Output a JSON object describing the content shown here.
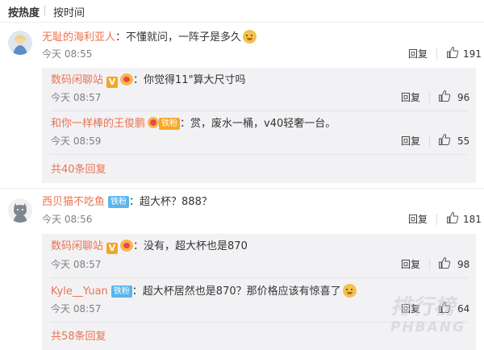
{
  "sort": {
    "hot": "按热度",
    "time": "按时间"
  },
  "comments": [
    {
      "user": "无耻的海利亚人",
      "text": "不懂就问，一阵子是多久",
      "time": "今天 08:55",
      "reply_label": "回复",
      "likes": "191",
      "replies": [
        {
          "user": "数码闲聊站",
          "text": "你觉得11\"算大尺寸吗",
          "time": "今天 08:57",
          "reply_label": "回复",
          "likes": "96"
        },
        {
          "user": "和你一样棒的王俊鹏",
          "fan_tag": "铁粉",
          "text": "赏，废水一桶，v40轻奢一台。",
          "time": "今天 08:59",
          "reply_label": "回复",
          "likes": "55"
        }
      ],
      "more": "共40条回复"
    },
    {
      "user": "西贝猫不吃鱼",
      "fan_tag": "铁粉",
      "text": "超大杯？888？",
      "time": "今天 08:56",
      "reply_label": "回复",
      "likes": "181",
      "replies": [
        {
          "user": "数码闲聊站",
          "text": "没有，超大杯也是870",
          "time": "今天 08:57",
          "reply_label": "回复",
          "likes": "98"
        },
        {
          "user": "Kyle__Yuan",
          "fan_tag": "铁粉",
          "text": "超大杯居然也是870？那价格应该有惊喜了",
          "time": "今天 08:57",
          "reply_label": "回复",
          "likes": "64"
        }
      ],
      "more": "共58条回复"
    }
  ],
  "watermark": {
    "cn": "排行榜",
    "en": "PHBANG"
  },
  "colors": {
    "username": "#eb7350",
    "panel_bg": "#f2f2f5",
    "meta": "#808080"
  },
  "icons": [
    "thumbs-up-icon",
    "verified-v-icon",
    "medal-icon",
    "doge-emoji-icon"
  ]
}
